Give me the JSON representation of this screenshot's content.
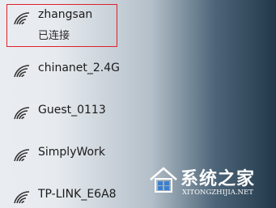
{
  "networks": [
    {
      "ssid": "zhangsan",
      "status": "已连接",
      "icon": "wifi-signal-icon",
      "connected": true
    },
    {
      "ssid": "chinanet_2.4G",
      "icon": "wifi-signal-icon"
    },
    {
      "ssid": "Guest_0113",
      "icon": "wifi-signal-icon"
    },
    {
      "ssid": "SimplyWork",
      "icon": "wifi-signal-icon"
    },
    {
      "ssid": "TP-LINK_E6A8",
      "icon": "wifi-signal-icon"
    }
  ],
  "watermark": {
    "title": "系统之家",
    "url": "XITONGZHIJIA.NET"
  },
  "colors": {
    "highlight_border": "#e0202a",
    "text": "#1a1a1a"
  }
}
